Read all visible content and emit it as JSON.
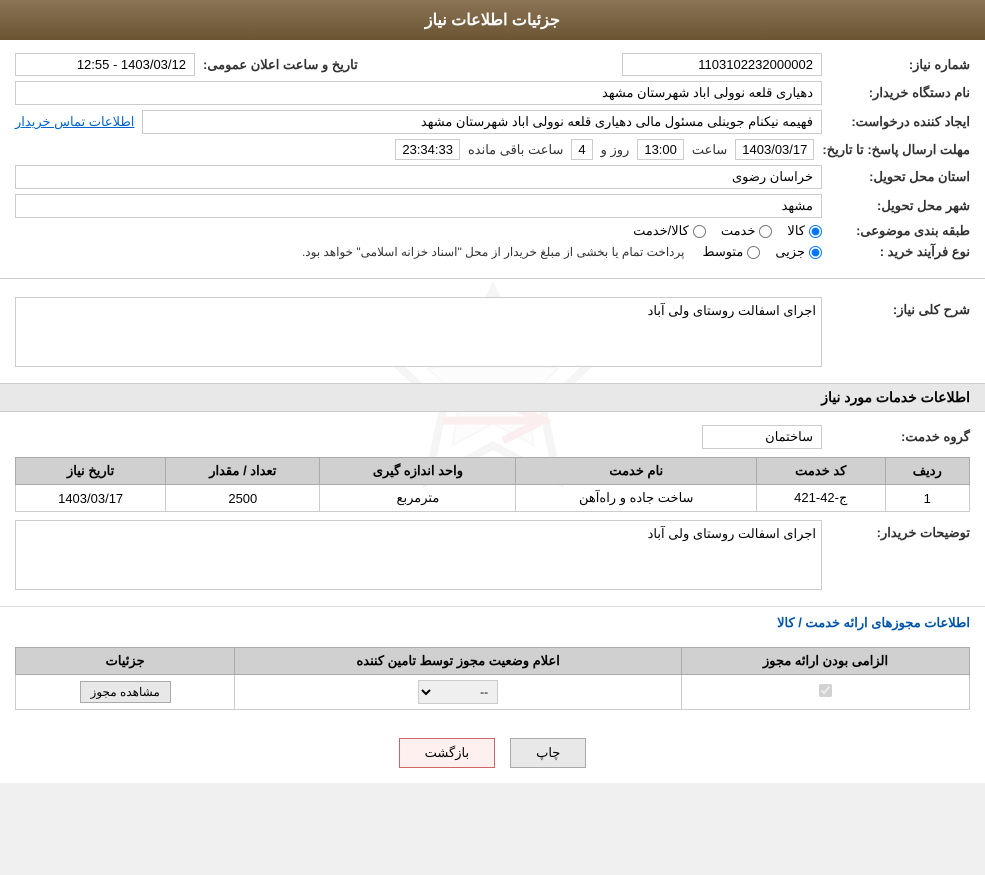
{
  "header": {
    "title": "جزئيات اطلاعات نياز"
  },
  "fields": {
    "shomara_niaz_label": "شماره نياز:",
    "shomara_niaz_value": "1103102232000002",
    "name_dastgah_label": "نام دستگاه خريدار:",
    "name_dastgah_value": "دهياری قلعه نوولی اباد شهرستان مشهد",
    "ejad_konande_label": "ايجاد كننده درخواست:",
    "ejad_konande_value": "فهيمه نيكنام جوينلی مسئول مالی دهياری قلعه نوولی اباد شهرستان مشهد",
    "etela_tamas_label": "اطلاعات تماس خريدار",
    "mohlat_ersal_label": "مهلت ارسال پاسخ: تا تاريخ:",
    "tarikh_value": "1403/03/17",
    "saat_label": "ساعت",
    "saat_value": "13:00",
    "roz_label": "روز و",
    "roz_value": "4",
    "saat_baghi_label": "ساعت باقی مانده",
    "saat_baghi_value": "23:34:33",
    "tarikh_ealaan_label": "تاريخ و ساعت اعلان عمومی:",
    "tarikh_ealaan_value": "1403/03/12 - 12:55",
    "ostan_label": "استان محل تحويل:",
    "ostan_value": "خراسان رضوی",
    "shahr_label": "شهر محل تحويل:",
    "shahr_value": "مشهد",
    "tabaqe_label": "طبقه بندی موضوعی:",
    "tabaqe_options": [
      {
        "label": "کالا",
        "value": "kala"
      },
      {
        "label": "خدمت",
        "value": "khedmat"
      },
      {
        "label": "کالا/خدمت",
        "value": "kala_khedmat"
      }
    ],
    "tabaqe_selected": "kala",
    "nooe_farayand_label": "نوع فرآيند خريد :",
    "nooe_farayand_options": [
      {
        "label": "جزیی",
        "value": "jozi"
      },
      {
        "label": "متوسط",
        "value": "motavaset"
      }
    ],
    "nooe_farayand_selected": "jozi",
    "nooe_farayand_desc": "پرداخت تمام يا بخشی از مبلغ خريدار از محل \"اسناد خزانه اسلامی\" خواهد بود.",
    "sharh_koli_label": "شرح کلی نياز:",
    "sharh_koli_value": "اجرای اسفالت روستای ولی آباد",
    "khadamat_section_title": "اطلاعات خدمات مورد نياز",
    "gorooh_khedmat_label": "گروه خدمت:",
    "gorooh_khedmat_value": "ساختمان"
  },
  "table": {
    "headers": [
      "رديف",
      "کد خدمت",
      "نام خدمت",
      "واحد اندازه گيری",
      "تعداد / مقدار",
      "تاريخ نياز"
    ],
    "rows": [
      {
        "radif": "1",
        "kod_khedmat": "ج-42-421",
        "nam_khedmat": "ساخت جاده و راه‌آهن",
        "vahed": "مترمربع",
        "tedad": "2500",
        "tarikh": "1403/03/17"
      }
    ]
  },
  "buyer_desc_label": "توضيحات خريدار:",
  "buyer_desc_value": "اجرای اسفالت روستای ولی آباد",
  "permit_section_title": "اطلاعات مجوزهای ارائه خدمت / کالا",
  "permit_table": {
    "headers": [
      "الزامی بودن ارائه مجوز",
      "اعلام وضعيت مجوز توسط تامين کننده",
      "جزئيات"
    ],
    "rows": [
      {
        "elzami": true,
        "eelam_vaziat": "--",
        "show_btn": "مشاهده مجوز"
      }
    ]
  },
  "buttons": {
    "print": "چاپ",
    "back": "بازگشت"
  }
}
